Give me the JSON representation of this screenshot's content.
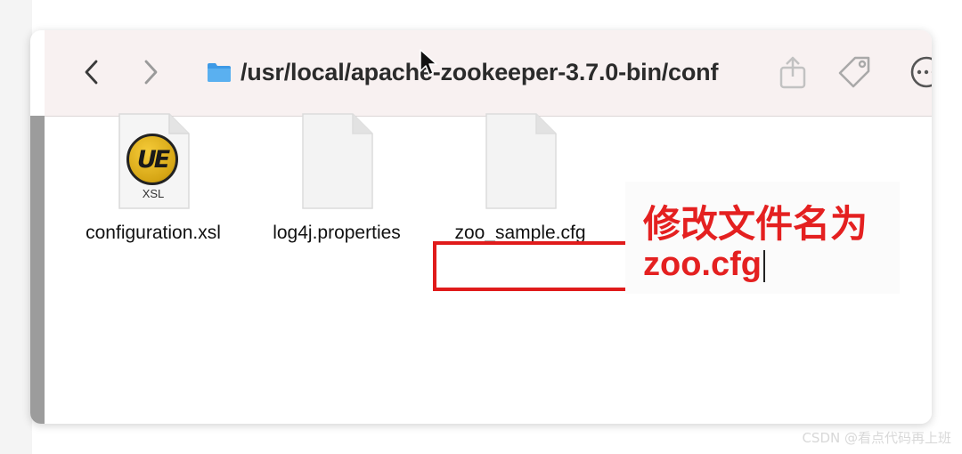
{
  "toolbar": {
    "path": "/usr/local/apache-zookeeper-3.7.0-bin/conf",
    "icons": [
      "chevron-left-icon",
      "chevron-right-icon",
      "folder-icon",
      "share-icon",
      "tag-icon",
      "more-icon"
    ]
  },
  "files": [
    {
      "name": "configuration.xsl",
      "badge": "UE",
      "type_label": "XSL",
      "icon": "ultraedit-xsl-icon"
    },
    {
      "name": "log4j.properties",
      "icon": "document-icon"
    },
    {
      "name": "zoo_sample.cfg",
      "icon": "document-icon"
    }
  ],
  "annotation": {
    "line1": "修改文件名为",
    "line2": "zoo.cfg",
    "color": "#e42020"
  },
  "watermark": "CSDN @看点代码再上班"
}
